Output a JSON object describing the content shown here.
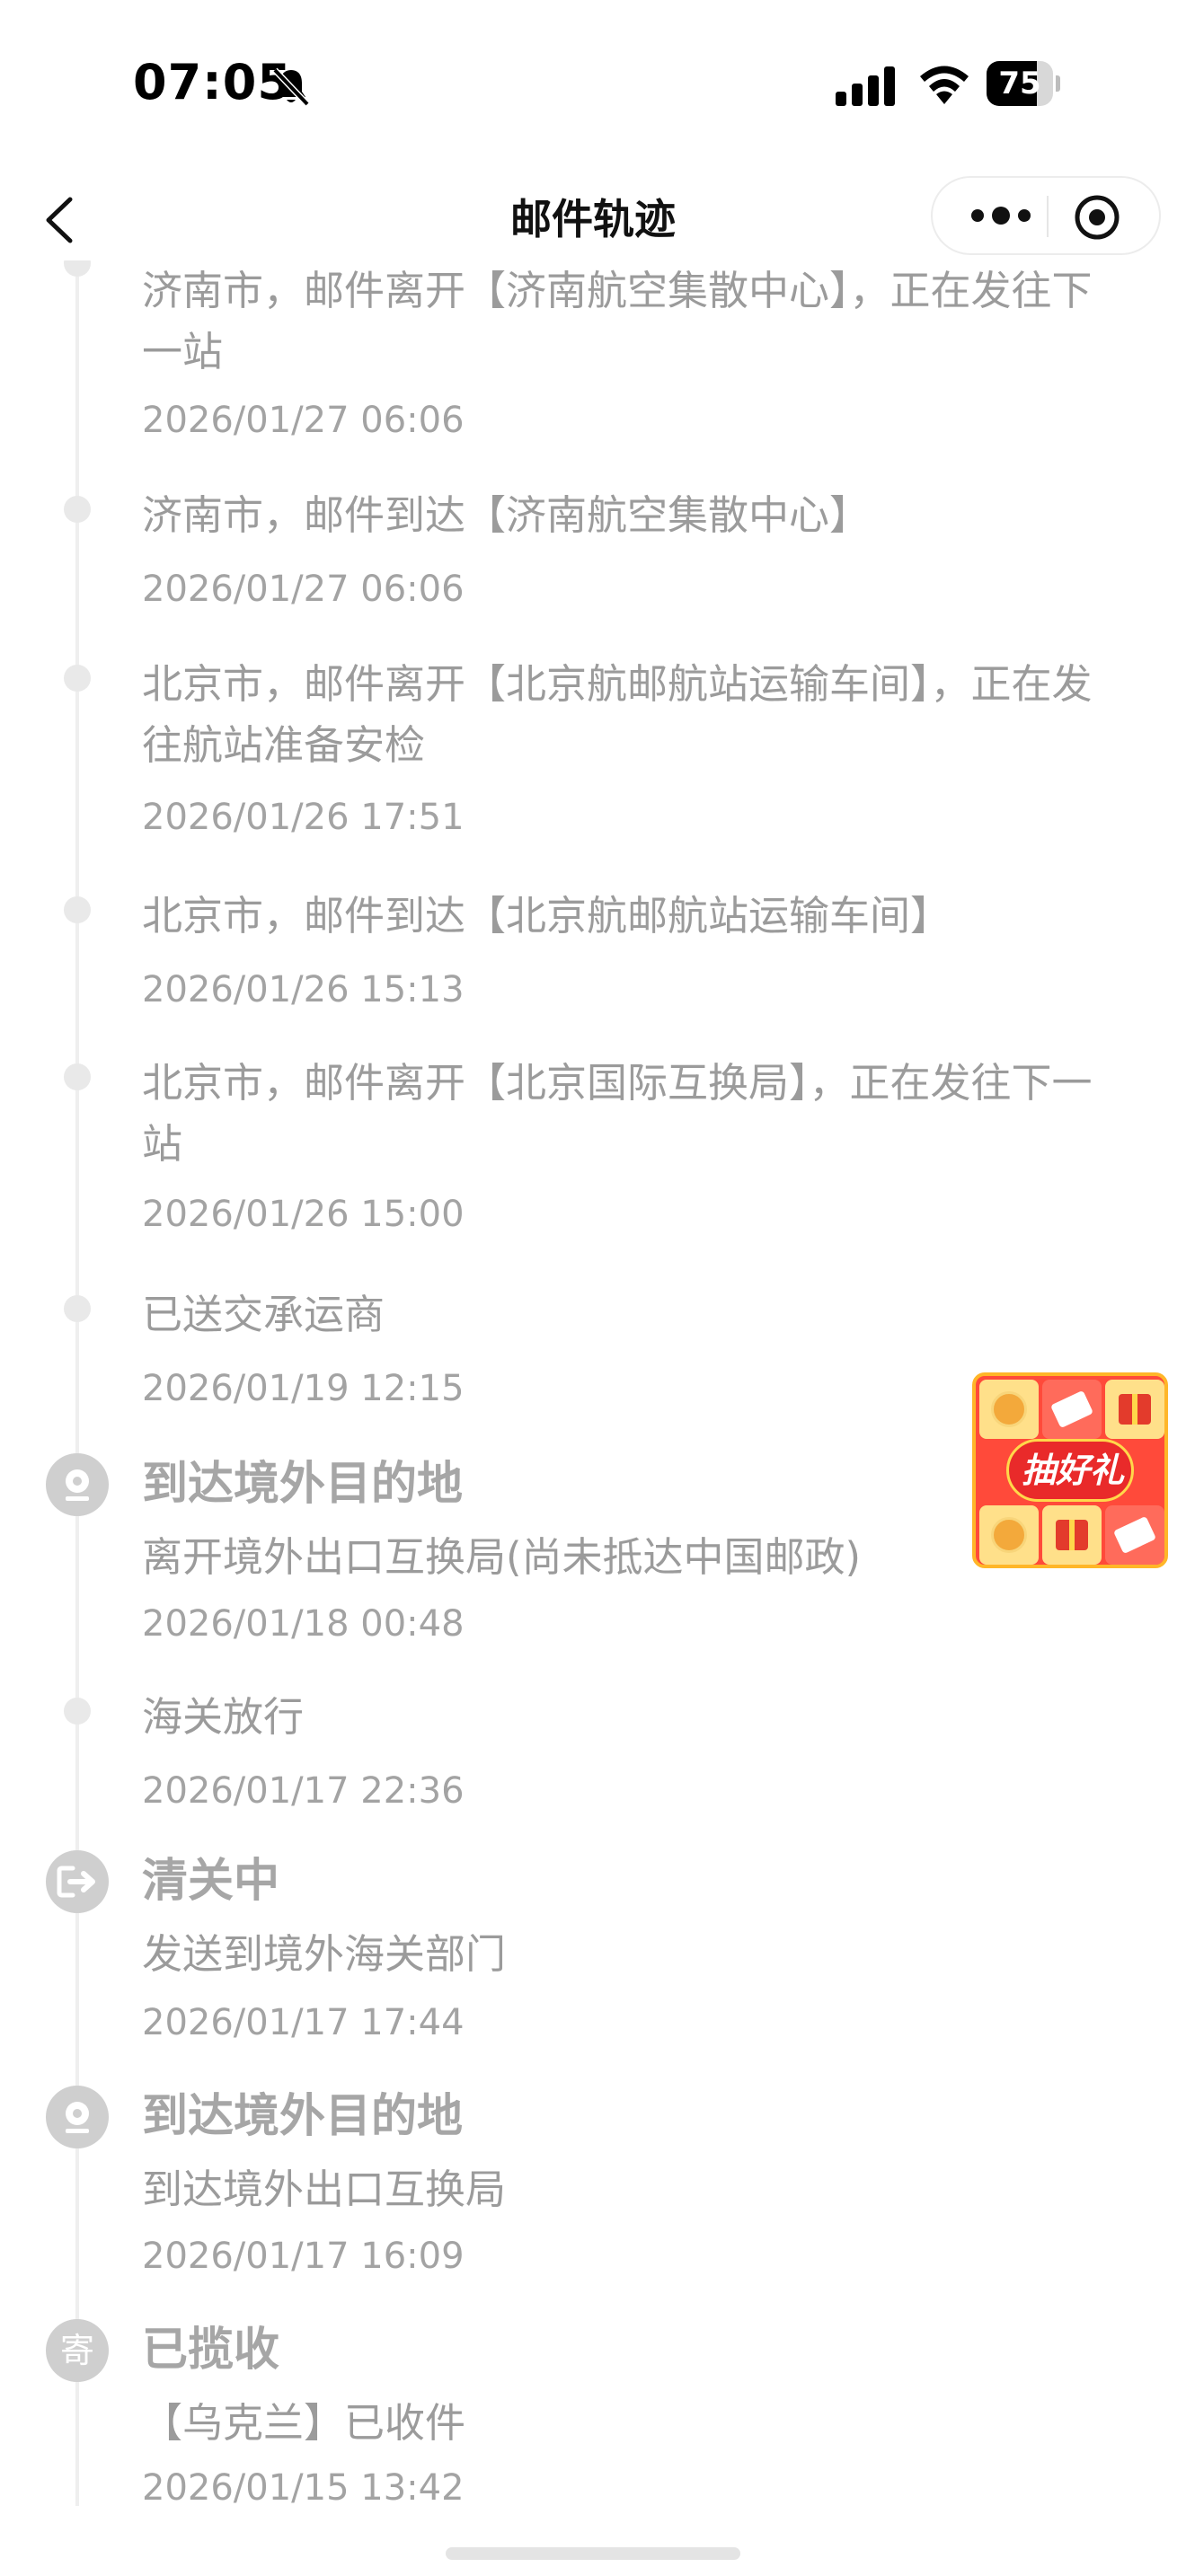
{
  "status_bar": {
    "time": "07:05",
    "battery_level": "75",
    "battery_fraction": 0.75,
    "icons": [
      "bell-muted-icon",
      "cellular-signal-icon",
      "wifi-icon",
      "battery-icon"
    ]
  },
  "nav": {
    "title": "邮件轨迹",
    "icons": [
      "back-arrow-icon",
      "more-dots-icon",
      "mini-program-close-icon"
    ]
  },
  "timeline": [
    {
      "text": "济南市，邮件离开【济南航空集散中心】，正在发往下一站",
      "time": "2026/01/27 06:06"
    },
    {
      "text": "济南市，邮件到达【济南航空集散中心】",
      "time": "2026/01/27 06:06"
    },
    {
      "text": "北京市，邮件离开【北京航邮航站运输车间】，正在发往航站准备安检",
      "time": "2026/01/26 17:51"
    },
    {
      "text": "北京市，邮件到达【北京航邮航站运输车间】",
      "time": "2026/01/26 15:13"
    },
    {
      "text": "北京市，邮件离开【北京国际互换局】，正在发往下一站",
      "time": "2026/01/26 15:00"
    },
    {
      "text": "已送交承运商",
      "time": "2026/01/19 12:15"
    },
    {
      "status": "到达境外目的地",
      "icon": "location-pin-icon",
      "text": "离开境外出口互换局(尚未抵达中国邮政)",
      "time": "2026/01/18 00:48"
    },
    {
      "text": "海关放行",
      "time": "2026/01/17 22:36"
    },
    {
      "status": "清关中",
      "icon": "customs-exit-icon",
      "text": "发送到境外海关部门",
      "time": "2026/01/17 17:44"
    },
    {
      "status": "到达境外目的地",
      "icon": "location-pin-icon",
      "text": "到达境外出口互换局",
      "time": "2026/01/17 16:09"
    },
    {
      "status": "已揽收",
      "icon_char": "寄",
      "text": "【乌克兰】已收件",
      "time": "2026/01/15 13:42"
    }
  ],
  "badge": {
    "label": "抽好礼",
    "colors": {
      "background": "#ff4a3a",
      "border": "#ffb628"
    }
  },
  "colors": {
    "text_muted": "#9b9b9b",
    "timeline_line": "#efefef",
    "status_icon": "#cfcfcf"
  }
}
